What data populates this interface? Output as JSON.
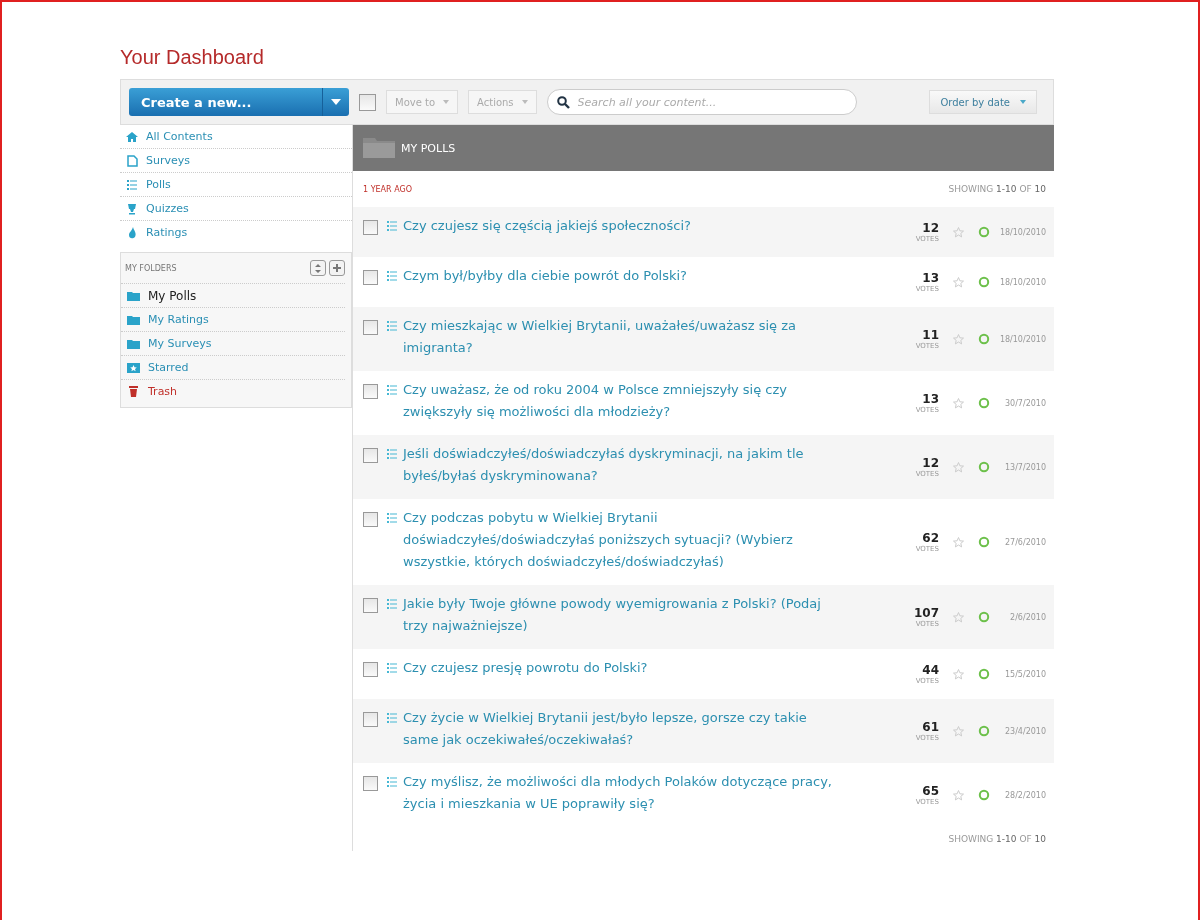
{
  "page_title": "Your Dashboard",
  "toolbar": {
    "create_button": "Create a new...",
    "select_all": {
      "checked": false
    },
    "move_to": "Move to",
    "actions": "Actions",
    "search": {
      "placeholder": "Search all your content..."
    },
    "order": "Order by date"
  },
  "sidebar": {
    "items": [
      {
        "label": "All Contents",
        "kind": "home",
        "selected": false
      },
      {
        "label": "Surveys",
        "kind": "surveys",
        "selected": false
      },
      {
        "label": "Polls",
        "kind": "polls",
        "selected": false
      },
      {
        "label": "Quizzes",
        "kind": "quizzes",
        "selected": false
      },
      {
        "label": "Ratings",
        "kind": "ratings",
        "selected": false
      }
    ],
    "folders_heading": "MY FOLDERS",
    "folders": [
      {
        "label": "My Polls",
        "kind": "folder",
        "selected": true
      },
      {
        "label": "My Ratings",
        "kind": "folder",
        "selected": false
      },
      {
        "label": "My Surveys",
        "kind": "folder",
        "selected": false
      },
      {
        "label": "Starred",
        "kind": "starred",
        "selected": false
      },
      {
        "label": "Trash",
        "kind": "trash",
        "selected": false
      }
    ]
  },
  "main": {
    "folder_title": "MY POLLS",
    "group_label": "1 YEAR AGO",
    "paging_top": {
      "label": "SHOWING",
      "range": "1-10",
      "of": "OF",
      "total": "10"
    },
    "rows": [
      {
        "title": "Czy czujesz się częścią jakiejś społeczności?",
        "votes": "12",
        "votes_label": "VOTES",
        "date": "18/10/2010",
        "checked": false,
        "starred": false
      },
      {
        "title": "Czym był/byłby dla ciebie powrót do Polski?",
        "votes": "13",
        "votes_label": "VOTES",
        "date": "18/10/2010",
        "checked": false,
        "starred": false
      },
      {
        "title": "Czy mieszkając w Wielkiej Brytanii, uważałeś/uważasz się za imigranta?",
        "votes": "11",
        "votes_label": "VOTES",
        "date": "18/10/2010",
        "checked": false,
        "starred": false
      },
      {
        "title": "Czy uważasz, że od roku 2004 w Polsce zmniejszyły się czy zwiększyły się możliwości dla młodzieży?",
        "votes": "13",
        "votes_label": "VOTES",
        "date": "30/7/2010",
        "checked": false,
        "starred": false
      },
      {
        "title": "Jeśli doświadczyłeś/doświadczyłaś dyskryminacji, na jakim tle byłeś/byłaś dyskryminowana?",
        "votes": "12",
        "votes_label": "VOTES",
        "date": "13/7/2010",
        "checked": false,
        "starred": false
      },
      {
        "title": "Czy podczas pobytu w Wielkiej Brytanii doświadczyłeś/doświadczyłaś poniższych sytuacji? (Wybierz wszystkie, których doświadczyłeś/doświadczyłaś)",
        "votes": "62",
        "votes_label": "VOTES",
        "date": "27/6/2010",
        "checked": false,
        "starred": false
      },
      {
        "title": "Jakie były Twoje główne powody wyemigrowania z Polski? (Podaj trzy najważniejsze)",
        "votes": "107",
        "votes_label": "VOTES",
        "date": "2/6/2010",
        "checked": false,
        "starred": false
      },
      {
        "title": "Czy czujesz presję powrotu do Polski?",
        "votes": "44",
        "votes_label": "VOTES",
        "date": "15/5/2010",
        "checked": false,
        "starred": false
      },
      {
        "title": "Czy życie w Wielkiej Brytanii jest/było lepsze, gorsze czy takie same jak oczekiwałeś/oczekiwałaś?",
        "votes": "61",
        "votes_label": "VOTES",
        "date": "23/4/2010",
        "checked": false,
        "starred": false
      },
      {
        "title": "Czy myślisz, że możliwości dla młodych Polaków dotyczące pracy, życia i mieszkania w UE poprawiły się?",
        "votes": "65",
        "votes_label": "VOTES",
        "date": "28/2/2010",
        "checked": false,
        "starred": false
      }
    ],
    "paging_bottom": {
      "label": "SHOWING",
      "range": "1-10",
      "of": "OF",
      "total": "10"
    }
  }
}
